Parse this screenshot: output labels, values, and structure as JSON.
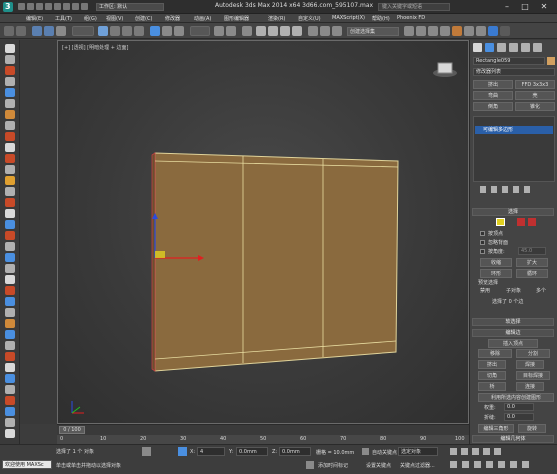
{
  "app": {
    "workspace_label": "工作区: 默认",
    "title": "Autodesk 3ds Max  2014 x64      3d66.com_595107.max",
    "search_placeholder": "键入关键字或短语"
  },
  "menu": [
    "编辑(E)",
    "工具(T)",
    "组(G)",
    "视图(V)",
    "创建(C)",
    "修改器",
    "动画(A)",
    "图形编辑器",
    "渲染(R)",
    "自定义(U)",
    "MAXScript(X)",
    "帮助(H)",
    "Phoenix FD"
  ],
  "toolbar": {
    "selection_set": "创建选择集"
  },
  "viewport": {
    "label": "[+] [透视] [明暗处理 + 边面]"
  },
  "command_panel": {
    "object_name": "Rectangle059",
    "modifier_list": "修改器列表",
    "buttons": {
      "extrude": "挤出",
      "ffd": "FFD 3x3x3",
      "bend": "弯曲",
      "shell": "壳",
      "chamfer": "倒角",
      "taper": "锥化"
    },
    "stack_item": "可编辑多边形",
    "selection": {
      "title": "选择",
      "by_vertex": "按顶点",
      "ignore_backfacing": "忽略背面",
      "by_angle": "按角度:",
      "angle_value": "45.0",
      "shrink": "收缩",
      "grow": "扩大",
      "ring": "环形",
      "loop": "循环",
      "preview_selection": "预览选择",
      "disabled": "禁用",
      "sub_object": "子对象",
      "multi": "多个",
      "selected_count": "选择了 0 个边"
    },
    "soft_selection": "软选择",
    "edit_edges": {
      "title": "编辑边",
      "insert_vertex": "插入顶点",
      "remove": "移除",
      "split": "分割",
      "extrude": "挤出",
      "weld": "焊接",
      "chamfer": "切角",
      "target_weld": "目标焊接",
      "bridge": "桥",
      "connect": "连接",
      "create_shape": "利用所选内容创建图形",
      "weight_label": "权重:",
      "weight_value": "0.0",
      "crease_label": "折缝:",
      "crease_value": "0.0",
      "edit_tri": "编辑三角形",
      "turn": "旋转"
    },
    "edit_geometry": "编辑几何体"
  },
  "timeline": {
    "frame": "0 / 100",
    "ticks": [
      "0",
      "10",
      "20",
      "30",
      "40",
      "50",
      "60",
      "70",
      "80",
      "90",
      "100"
    ]
  },
  "status": {
    "welcome": "欢迎使用 MAXSc",
    "selected": "选择了 1 个 对象",
    "hint": "单击或单击并拖动以选择对象",
    "x_label": "X:",
    "x_value": "4",
    "y_label": "Y:",
    "y_value": "0.0mm",
    "z_label": "Z:",
    "z_value": "0.0mm",
    "grid": "栅格 = 10.0mm",
    "add_time_tag": "添加时间标记",
    "auto_key": "自动关键点",
    "set_key": "设置关键点",
    "selected_obj": "选定对象",
    "key_filter": "关键点过滤器..."
  }
}
